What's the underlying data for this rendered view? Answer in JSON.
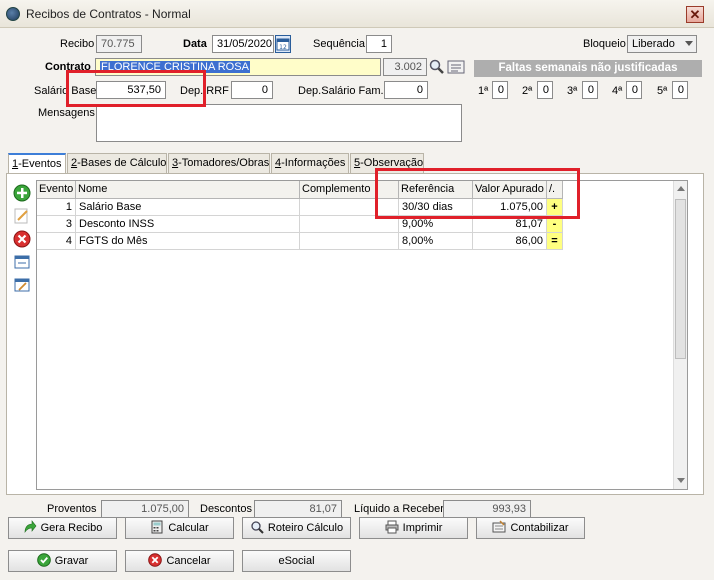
{
  "window": {
    "title": "Recibos de Contratos - Normal",
    "close": "✕"
  },
  "header": {
    "recibo_label": "Recibo",
    "recibo_value": "70.775",
    "data_label": "Data",
    "data_value": "31/05/2020",
    "sequencia_label": "Sequência",
    "sequencia_value": "1",
    "bloqueio_label": "Bloqueio",
    "bloqueio_value": "Liberado",
    "contrato_label": "Contrato",
    "contrato_name": "FLORENCE CRISTINA ROSA",
    "contrato_code": "3.002",
    "salario_label": "Salário Base",
    "salario_value": "537,50",
    "depirrf_label": "Dep.IRRF",
    "depirrf_value": "0",
    "depsal_label": "Dep.Salário Fam.",
    "depsal_value": "0",
    "mensagens_label": "Mensagens",
    "mensagens_value": ""
  },
  "faltas": {
    "title": "Faltas semanais não justificadas",
    "weeks": [
      {
        "label": "1ª",
        "value": "0"
      },
      {
        "label": "2ª",
        "value": "0"
      },
      {
        "label": "3ª",
        "value": "0"
      },
      {
        "label": "4ª",
        "value": "0"
      },
      {
        "label": "5ª",
        "value": "0"
      }
    ]
  },
  "tabs": [
    {
      "key": "1",
      "label": "-Eventos"
    },
    {
      "key": "2",
      "label": "-Bases de Cálculo"
    },
    {
      "key": "3",
      "label": "-Tomadores/Obras"
    },
    {
      "key": "4",
      "label": "-Informações"
    },
    {
      "key": "5",
      "label": "-Observação"
    }
  ],
  "grid": {
    "columns": [
      "Evento",
      "Nome",
      "Complemento",
      "Referência",
      "Valor Apurado",
      "/."
    ],
    "rows": [
      {
        "evento": "1",
        "nome": "Salário Base",
        "complemento": "",
        "referencia": "30/30 dias",
        "valor": "1.075,00",
        "sign": "+"
      },
      {
        "evento": "3",
        "nome": "Desconto INSS",
        "complemento": "",
        "referencia": "9,00%",
        "valor": "81,07",
        "sign": "-"
      },
      {
        "evento": "4",
        "nome": "FGTS do Mês",
        "complemento": "",
        "referencia": "8,00%",
        "valor": "86,00",
        "sign": "="
      }
    ]
  },
  "totals": {
    "proventos_label": "Proventos",
    "proventos_value": "1.075,00",
    "descontos_label": "Descontos",
    "descontos_value": "81,07",
    "liquido_label": "Líquido a Receber",
    "liquido_value": "993,93"
  },
  "buttons": {
    "gera_recibo": "Gera Recibo",
    "calcular": "Calcular",
    "roteiro": "Roteiro Cálculo",
    "imprimir": "Imprimir",
    "contabilizar": "Contabilizar",
    "gravar": "Gravar",
    "cancelar": "Cancelar",
    "esocial": "eSocial"
  },
  "colors": {
    "highlight_red": "#e0202a",
    "accent_yellow": "#ffff80",
    "faltas_bg": "#aeaeae"
  }
}
